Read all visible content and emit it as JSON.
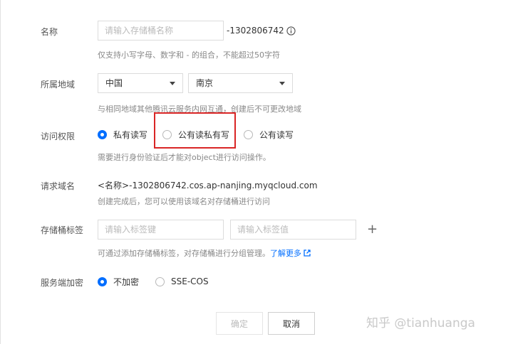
{
  "name": {
    "label": "名称",
    "placeholder": "请输入存储桶名称",
    "suffix": "-1302806742",
    "hint": "仅支持小写字母、数字和 - 的组合，不能超过50字符"
  },
  "region": {
    "label": "所属地域",
    "country": "中国",
    "city": "南京",
    "hint": "与相同地域其他腾讯云服务内网互通，创建后不可更改地域"
  },
  "access": {
    "label": "访问权限",
    "options": [
      "私有读写",
      "公有读私有写",
      "公有读写"
    ],
    "selected": "私有读写",
    "hint": "需要进行身份验证后才能对object进行访问操作。"
  },
  "domain": {
    "label": "请求域名",
    "value": "<名称>-1302806742.cos.ap-nanjing.myqcloud.com",
    "hint": "创建完成后，您可以使用该域名对存储桶进行访问"
  },
  "tags": {
    "label": "存储桶标签",
    "key_placeholder": "请输入标签键",
    "value_placeholder": "请输入标签值",
    "add": "+",
    "hint": "可通过添加存储桶标签，对存储桶进行分组管理。",
    "link": "了解更多"
  },
  "encryption": {
    "label": "服务端加密",
    "options": [
      "不加密",
      "SSE-COS"
    ],
    "selected": "不加密"
  },
  "buttons": {
    "confirm": "确定",
    "cancel": "取消"
  },
  "watermark": "知乎 @tianhuanga",
  "colors": {
    "accent": "#006eff",
    "highlight": "#d92525"
  }
}
